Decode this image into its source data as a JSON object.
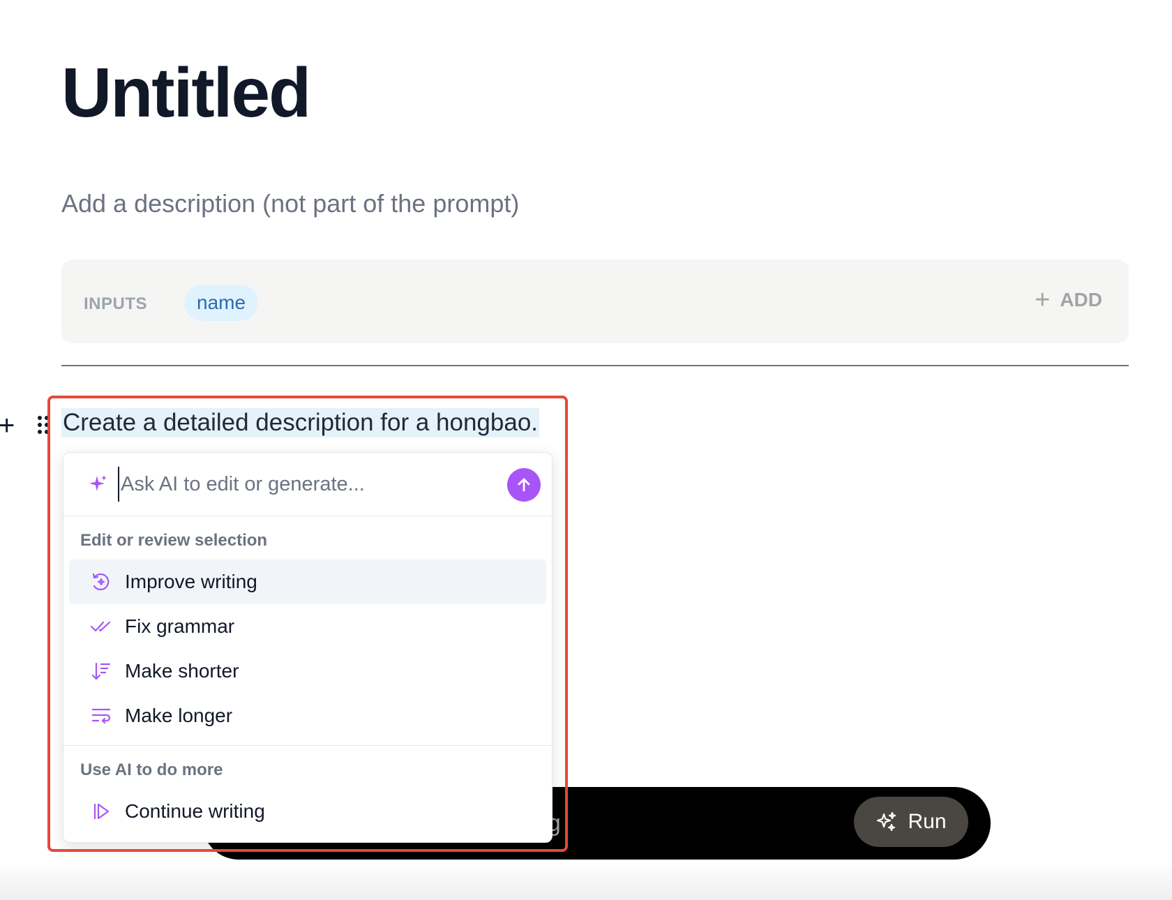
{
  "page": {
    "title": "Untitled",
    "description_placeholder": "Add a description (not part of the prompt)"
  },
  "inputs": {
    "label": "INPUTS",
    "chips": [
      "name"
    ],
    "add_label": "ADD"
  },
  "editor": {
    "prompt_text": "Create a detailed description for a hongbao."
  },
  "ai_menu": {
    "input_placeholder": "Ask AI to edit or generate...",
    "sections": [
      {
        "heading": "Edit or review selection",
        "items": [
          {
            "label": "Improve writing",
            "icon": "refresh-sparkle-icon"
          },
          {
            "label": "Fix grammar",
            "icon": "double-check-icon"
          },
          {
            "label": "Make shorter",
            "icon": "sort-shorter-icon"
          },
          {
            "label": "Make longer",
            "icon": "wrap-longer-icon"
          }
        ]
      },
      {
        "heading": "Use AI to do more",
        "items": [
          {
            "label": "Continue writing",
            "icon": "play-forward-icon"
          }
        ]
      }
    ],
    "accent_color": "#a855f7"
  },
  "bottom_bar": {
    "placeholder_fragment": "thing",
    "run_label": "Run"
  },
  "colors": {
    "highlight_border": "#e5483b",
    "chip_bg": "#e0f2fe",
    "chip_text": "#2b6cb0"
  }
}
